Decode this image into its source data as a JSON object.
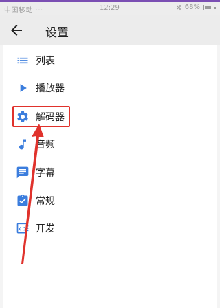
{
  "status_bar": {
    "left": "中国移动 ···",
    "time": "12:29",
    "bluetooth_icon": "bluetooth-icon",
    "battery": "68%"
  },
  "app_bar": {
    "back_icon": "arrow-back-icon",
    "title": "设置"
  },
  "menu": [
    {
      "label": "列表",
      "icon": "list-icon"
    },
    {
      "label": "播放器",
      "icon": "play-icon"
    },
    {
      "label": "解码器",
      "icon": "gear-icon",
      "highlighted": true
    },
    {
      "label": "音频",
      "icon": "music-note-icon"
    },
    {
      "label": "字幕",
      "icon": "subtitles-icon"
    },
    {
      "label": "常规",
      "icon": "checkbox-icon"
    },
    {
      "label": "开发",
      "icon": "developer-icon"
    }
  ],
  "colors": {
    "icon_blue": "#3b7ddd",
    "annotation_red": "#e0322c",
    "app_bar_bg": "#ececec"
  }
}
